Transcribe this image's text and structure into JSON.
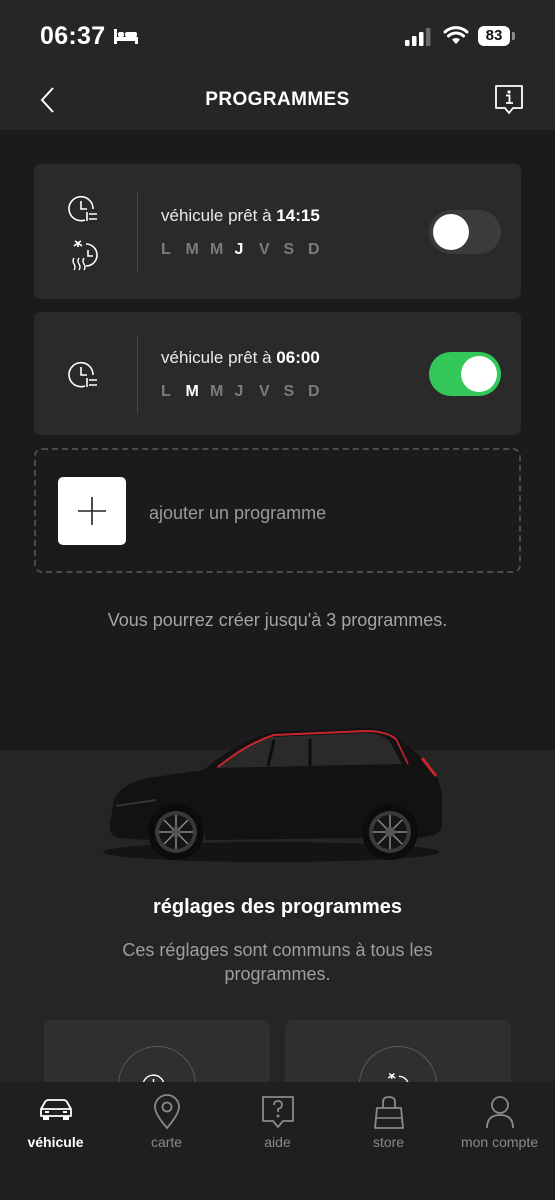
{
  "status_bar": {
    "time": "06:37",
    "battery": "83"
  },
  "header": {
    "title": "PROGRAMMES"
  },
  "programs": [
    {
      "ready_prefix": "véhicule prêt à ",
      "time": "14:15",
      "days": [
        "L",
        "M",
        "M",
        "J",
        "V",
        "S",
        "D"
      ],
      "active_days": [
        3
      ],
      "enabled": false
    },
    {
      "ready_prefix": "véhicule prêt à ",
      "time": "06:00",
      "days": [
        "L",
        "M",
        "M",
        "J",
        "V",
        "S",
        "D"
      ],
      "active_days": [
        1
      ],
      "enabled": true
    }
  ],
  "add_program": {
    "label": "ajouter un programme"
  },
  "limit_note": "Vous pourrez créer jusqu'à 3 programmes.",
  "settings": {
    "title": "réglages des programmes",
    "description": "Ces réglages sont communs à tous les programmes."
  },
  "nav": [
    {
      "label": "véhicule",
      "icon": "car-icon",
      "active": true
    },
    {
      "label": "carte",
      "icon": "map-pin-icon",
      "active": false
    },
    {
      "label": "aide",
      "icon": "help-icon",
      "active": false
    },
    {
      "label": "store",
      "icon": "shopping-bag-icon",
      "active": false
    },
    {
      "label": "mon compte",
      "icon": "user-icon",
      "active": false
    }
  ],
  "colors": {
    "toggle_on": "#34c759",
    "accent_red": "#c8262d"
  }
}
